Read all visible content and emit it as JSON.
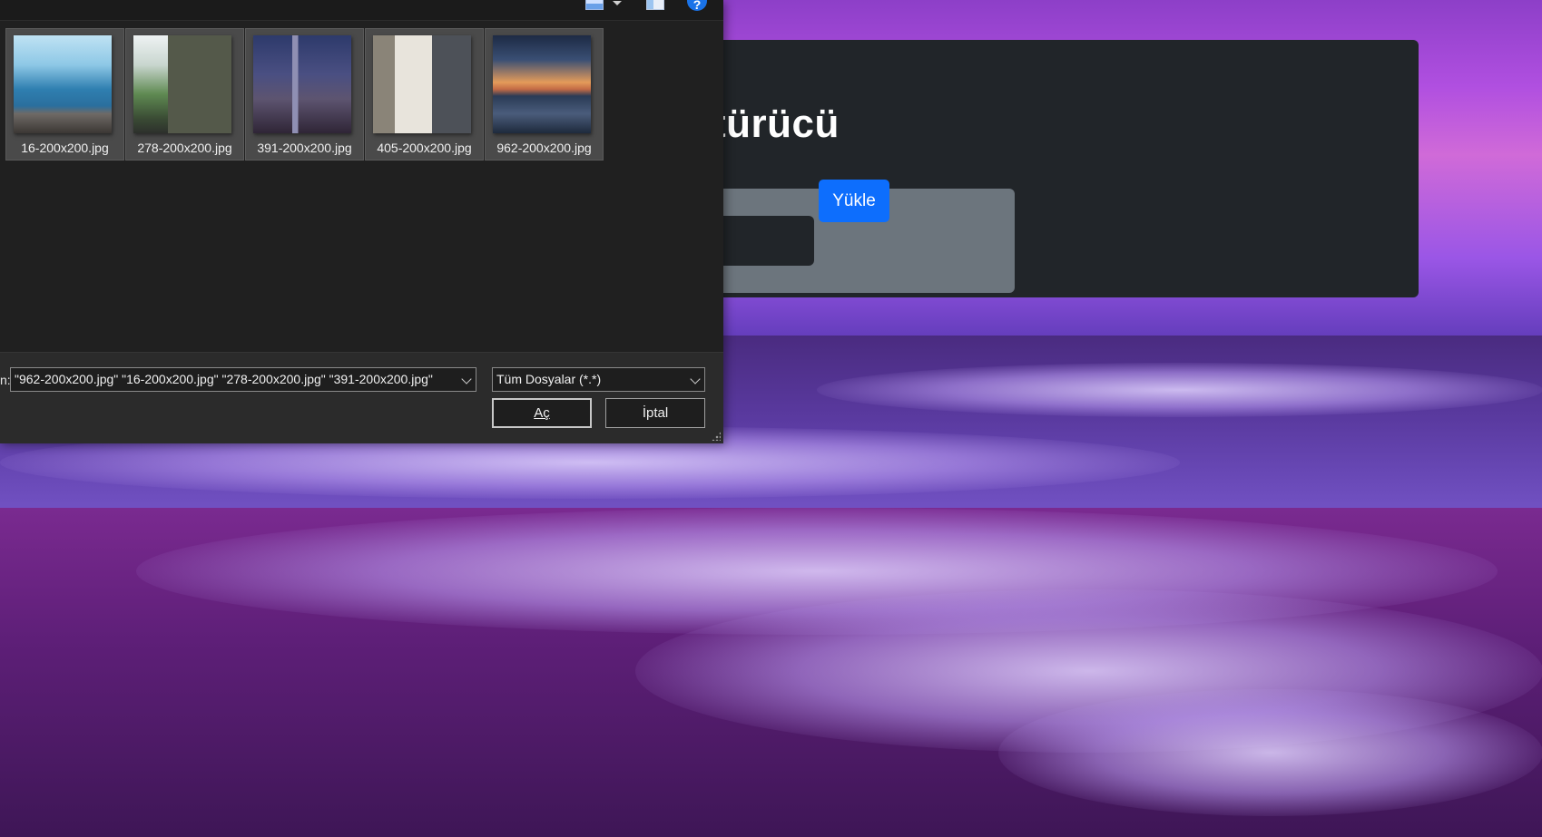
{
  "page": {
    "title": "ştürücü",
    "upload_button": "Yükle"
  },
  "dialog": {
    "toolbar": {
      "help_glyph": "?"
    },
    "files": [
      {
        "name": "16-200x200.jpg",
        "preview": "sea-rocks"
      },
      {
        "name": "278-200x200.jpg",
        "preview": "mountain-road"
      },
      {
        "name": "391-200x200.jpg",
        "preview": "city-night"
      },
      {
        "name": "405-200x200.jpg",
        "preview": "street-buildings"
      },
      {
        "name": "962-200x200.jpg",
        "preview": "sunset-sea"
      }
    ],
    "file_name_caption": "n:",
    "file_name_value": "\"962-200x200.jpg\" \"16-200x200.jpg\" \"278-200x200.jpg\" \"391-200x200.jpg\"",
    "file_type_value": "Tüm Dosyalar (*.*)",
    "open_button": "Aç",
    "cancel_button": "İptal"
  },
  "colors": {
    "card_bg": "#212529",
    "upload_panel_bg": "#6c757d",
    "primary_button": "#0d6efd",
    "dialog_bg": "#202020"
  }
}
